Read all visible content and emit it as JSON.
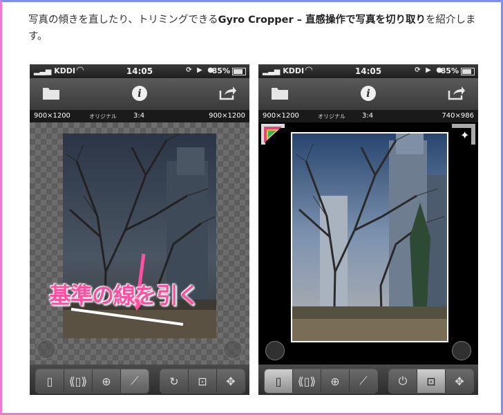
{
  "intro": {
    "prefix": "写真の傾きを直したり、トリミングできる",
    "app_name": "Gyro Cropper – 直感操作で写真を切り取り",
    "suffix": "を紹介します。"
  },
  "phones": [
    {
      "status": {
        "carrier": "KDDI",
        "time": "14:05",
        "battery": "85%"
      },
      "info": {
        "left": "900×1200",
        "mode": "オリジナル",
        "ratio": "3:4",
        "right": "900×1200"
      },
      "overlay_text": "基準の線を引く"
    },
    {
      "status": {
        "carrier": "KDDI",
        "time": "14:05",
        "battery": "85%"
      },
      "info": {
        "left": "900×1200",
        "mode": "オリジナル",
        "ratio": "3:4",
        "right": "740×986"
      }
    }
  ],
  "colors": {
    "overlay": "#ff4fa0",
    "frame_blue": "#7f8ff0",
    "frame_pink": "#f07ad0"
  },
  "icons": {
    "toolbar": [
      "folder-icon",
      "info-icon",
      "share-icon"
    ],
    "bottom_left": [
      "portrait-icon",
      "rotate-device-icon",
      "gyro-icon",
      "line-icon"
    ],
    "bottom_right_left_phone": [
      "rotate-icon",
      "crop-icon",
      "move-icon"
    ],
    "bottom_right_right_phone": [
      "power-icon",
      "crop-icon",
      "move-icon"
    ]
  }
}
